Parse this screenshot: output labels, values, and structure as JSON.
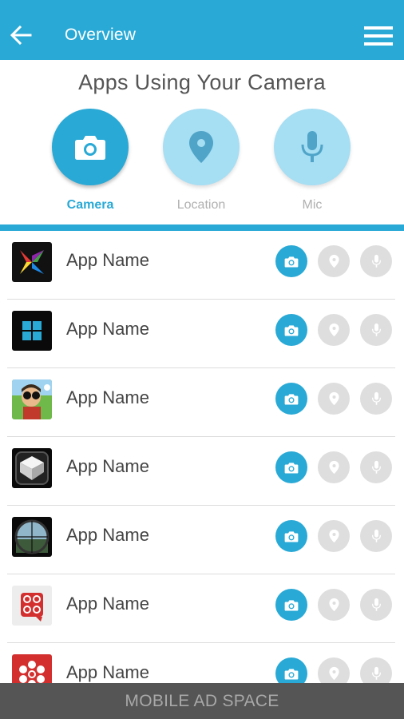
{
  "appbar": {
    "title": "Overview"
  },
  "header": {
    "title": "Apps Using Your Camera"
  },
  "permissions": [
    {
      "label": "Camera",
      "icon": "camera-icon",
      "active": true
    },
    {
      "label": "Location",
      "icon": "location-pin-icon",
      "active": false
    },
    {
      "label": "Mic",
      "icon": "microphone-icon",
      "active": false
    }
  ],
  "apps": [
    {
      "name": "App Name",
      "icon": "app-icon-x-logo"
    },
    {
      "name": "App Name",
      "icon": "app-icon-windows"
    },
    {
      "name": "App Name",
      "icon": "app-icon-cartoon"
    },
    {
      "name": "App Name",
      "icon": "app-icon-cube"
    },
    {
      "name": "App Name",
      "icon": "app-icon-scope"
    },
    {
      "name": "App Name",
      "icon": "app-icon-red-circles"
    },
    {
      "name": "App Name",
      "icon": "app-icon-cbc"
    }
  ],
  "ad": {
    "text": "MOBILE AD SPACE"
  },
  "colors": {
    "accent": "#29a9d6",
    "accent_light": "#a6def3",
    "inactive": "#dedede",
    "ad_bg": "#555555"
  }
}
